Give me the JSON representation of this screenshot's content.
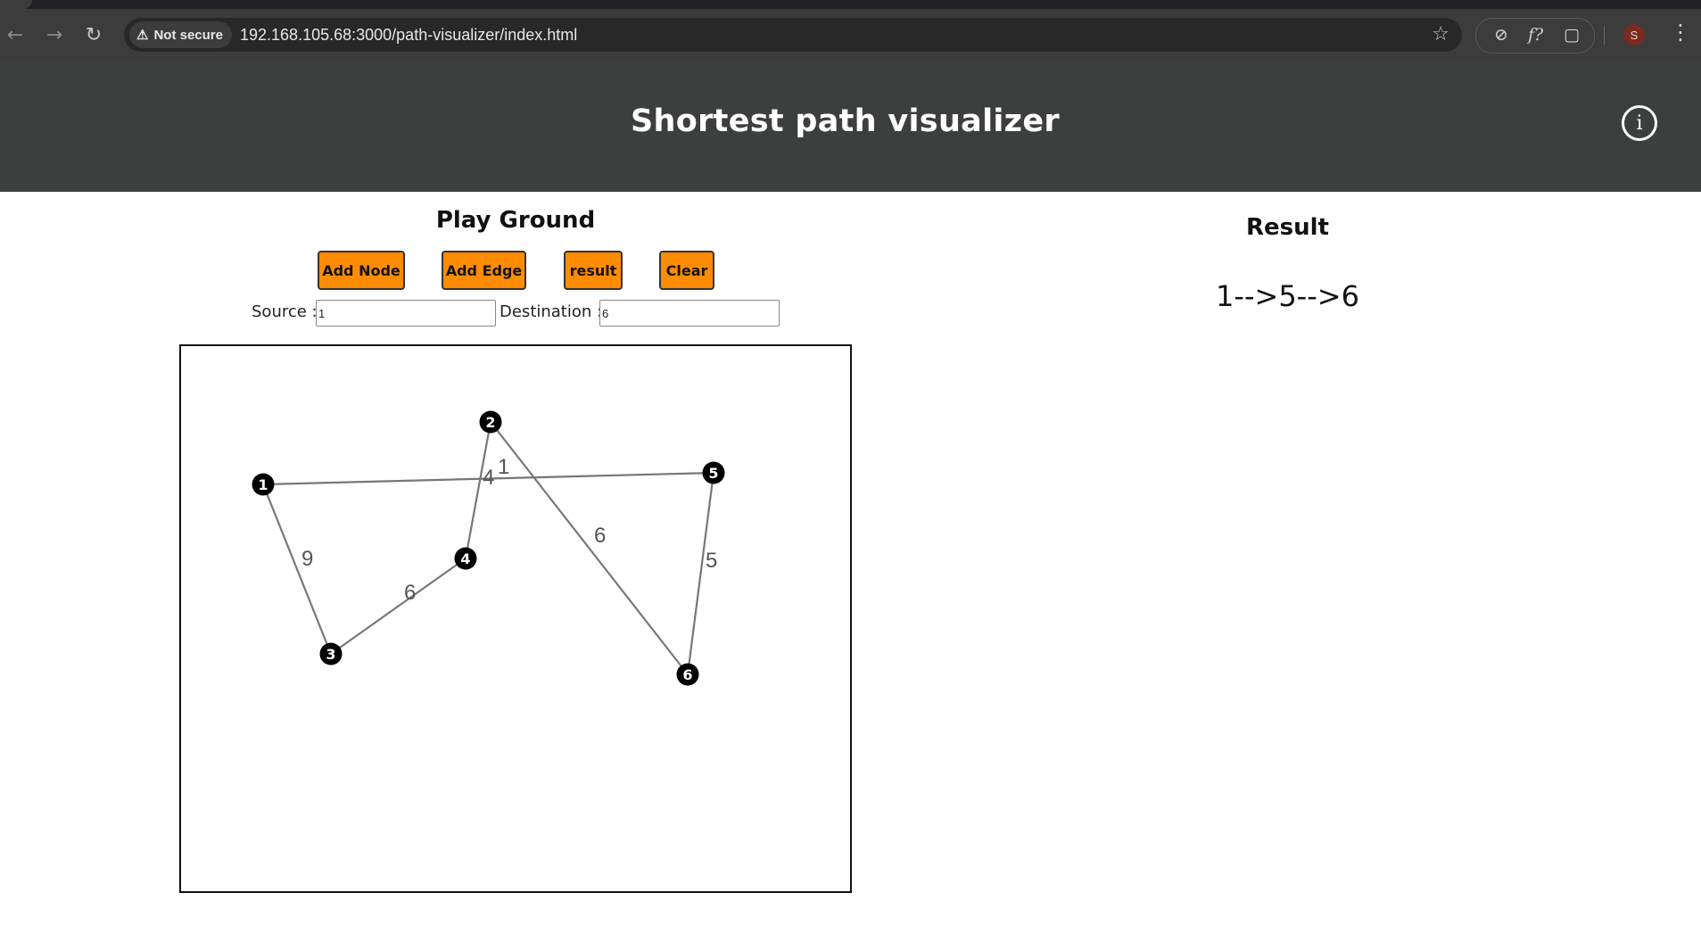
{
  "browser": {
    "security_label": "Not secure",
    "url": "192.168.105.68:3000/path-visualizer/index.html",
    "avatar_letter": "S"
  },
  "header": {
    "title": "Shortest path visualizer"
  },
  "playground": {
    "title": "Play Ground",
    "buttons": {
      "add_node": "Add Node",
      "add_edge": "Add Edge",
      "result": "result",
      "clear": "Clear"
    },
    "source_label": "Source :",
    "source_value": "1",
    "destination_label": "Destination :",
    "destination_value": "6"
  },
  "graph": {
    "nodes": [
      {
        "id": "1"
      },
      {
        "id": "2"
      },
      {
        "id": "3"
      },
      {
        "id": "4"
      },
      {
        "id": "5"
      },
      {
        "id": "6"
      }
    ],
    "edges": [
      {
        "from": "1",
        "to": "5",
        "weight": "1"
      },
      {
        "from": "1",
        "to": "3",
        "weight": "9"
      },
      {
        "from": "3",
        "to": "4",
        "weight": "6"
      },
      {
        "from": "4",
        "to": "2",
        "weight": "4"
      },
      {
        "from": "2",
        "to": "6",
        "weight": "6"
      },
      {
        "from": "5",
        "to": "6",
        "weight": "5"
      }
    ]
  },
  "result": {
    "title": "Result",
    "path": "1-->5-->6"
  },
  "colors": {
    "accent": "#ff8c00",
    "header_bg": "#3d3f3e",
    "edge": "#777777",
    "node": "#000000"
  }
}
